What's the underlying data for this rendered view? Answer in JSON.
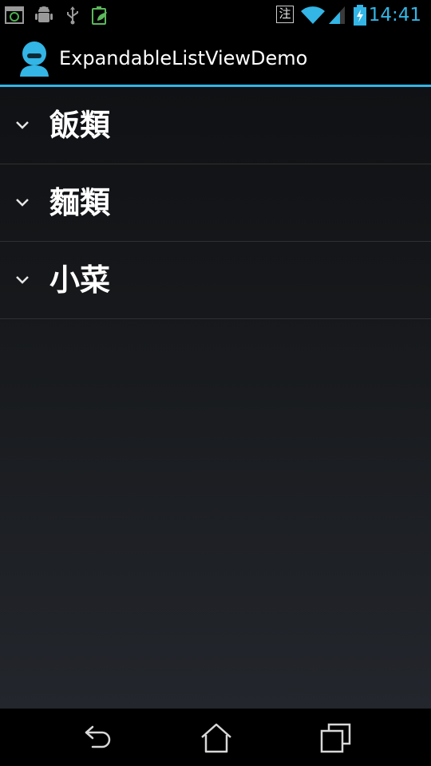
{
  "status_bar": {
    "time": "14:41",
    "ime_indicator": "注",
    "icons_left": [
      "screenshot-icon",
      "android-debug-icon",
      "usb-icon",
      "battery-saver-icon"
    ],
    "icons_right": [
      "wifi-icon",
      "signal-icon",
      "battery-charging-icon"
    ],
    "accent_color": "#33b5e5"
  },
  "action_bar": {
    "title": "ExpandableListViewDemo",
    "app_icon": "person-app-icon",
    "divider_color": "#33b5e5"
  },
  "list": {
    "groups": [
      {
        "label": "飯類",
        "expanded": false
      },
      {
        "label": "麵類",
        "expanded": false
      },
      {
        "label": "小菜",
        "expanded": false
      }
    ]
  },
  "nav_bar": {
    "buttons": [
      "back-icon",
      "home-icon",
      "recent-apps-icon"
    ]
  }
}
